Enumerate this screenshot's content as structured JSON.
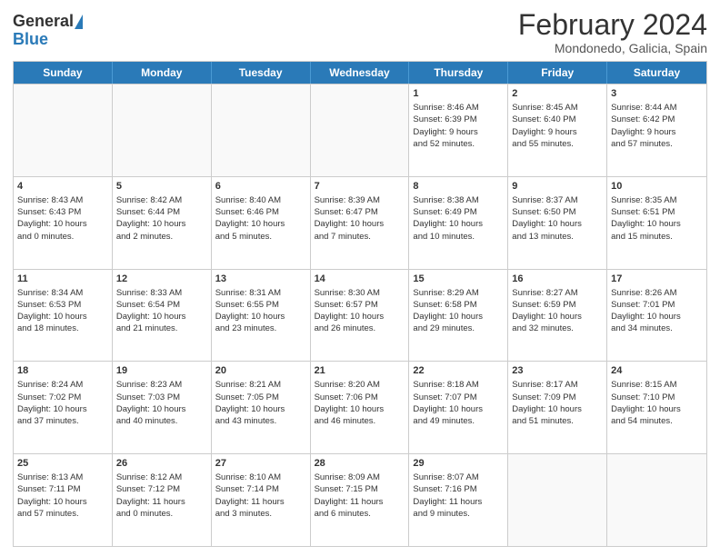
{
  "header": {
    "logo_general": "General",
    "logo_blue": "Blue",
    "month_year": "February 2024",
    "location": "Mondonedo, Galicia, Spain"
  },
  "days_of_week": [
    "Sunday",
    "Monday",
    "Tuesday",
    "Wednesday",
    "Thursday",
    "Friday",
    "Saturday"
  ],
  "weeks": [
    [
      {
        "day": "",
        "info": ""
      },
      {
        "day": "",
        "info": ""
      },
      {
        "day": "",
        "info": ""
      },
      {
        "day": "",
        "info": ""
      },
      {
        "day": "1",
        "info": "Sunrise: 8:46 AM\nSunset: 6:39 PM\nDaylight: 9 hours\nand 52 minutes."
      },
      {
        "day": "2",
        "info": "Sunrise: 8:45 AM\nSunset: 6:40 PM\nDaylight: 9 hours\nand 55 minutes."
      },
      {
        "day": "3",
        "info": "Sunrise: 8:44 AM\nSunset: 6:42 PM\nDaylight: 9 hours\nand 57 minutes."
      }
    ],
    [
      {
        "day": "4",
        "info": "Sunrise: 8:43 AM\nSunset: 6:43 PM\nDaylight: 10 hours\nand 0 minutes."
      },
      {
        "day": "5",
        "info": "Sunrise: 8:42 AM\nSunset: 6:44 PM\nDaylight: 10 hours\nand 2 minutes."
      },
      {
        "day": "6",
        "info": "Sunrise: 8:40 AM\nSunset: 6:46 PM\nDaylight: 10 hours\nand 5 minutes."
      },
      {
        "day": "7",
        "info": "Sunrise: 8:39 AM\nSunset: 6:47 PM\nDaylight: 10 hours\nand 7 minutes."
      },
      {
        "day": "8",
        "info": "Sunrise: 8:38 AM\nSunset: 6:49 PM\nDaylight: 10 hours\nand 10 minutes."
      },
      {
        "day": "9",
        "info": "Sunrise: 8:37 AM\nSunset: 6:50 PM\nDaylight: 10 hours\nand 13 minutes."
      },
      {
        "day": "10",
        "info": "Sunrise: 8:35 AM\nSunset: 6:51 PM\nDaylight: 10 hours\nand 15 minutes."
      }
    ],
    [
      {
        "day": "11",
        "info": "Sunrise: 8:34 AM\nSunset: 6:53 PM\nDaylight: 10 hours\nand 18 minutes."
      },
      {
        "day": "12",
        "info": "Sunrise: 8:33 AM\nSunset: 6:54 PM\nDaylight: 10 hours\nand 21 minutes."
      },
      {
        "day": "13",
        "info": "Sunrise: 8:31 AM\nSunset: 6:55 PM\nDaylight: 10 hours\nand 23 minutes."
      },
      {
        "day": "14",
        "info": "Sunrise: 8:30 AM\nSunset: 6:57 PM\nDaylight: 10 hours\nand 26 minutes."
      },
      {
        "day": "15",
        "info": "Sunrise: 8:29 AM\nSunset: 6:58 PM\nDaylight: 10 hours\nand 29 minutes."
      },
      {
        "day": "16",
        "info": "Sunrise: 8:27 AM\nSunset: 6:59 PM\nDaylight: 10 hours\nand 32 minutes."
      },
      {
        "day": "17",
        "info": "Sunrise: 8:26 AM\nSunset: 7:01 PM\nDaylight: 10 hours\nand 34 minutes."
      }
    ],
    [
      {
        "day": "18",
        "info": "Sunrise: 8:24 AM\nSunset: 7:02 PM\nDaylight: 10 hours\nand 37 minutes."
      },
      {
        "day": "19",
        "info": "Sunrise: 8:23 AM\nSunset: 7:03 PM\nDaylight: 10 hours\nand 40 minutes."
      },
      {
        "day": "20",
        "info": "Sunrise: 8:21 AM\nSunset: 7:05 PM\nDaylight: 10 hours\nand 43 minutes."
      },
      {
        "day": "21",
        "info": "Sunrise: 8:20 AM\nSunset: 7:06 PM\nDaylight: 10 hours\nand 46 minutes."
      },
      {
        "day": "22",
        "info": "Sunrise: 8:18 AM\nSunset: 7:07 PM\nDaylight: 10 hours\nand 49 minutes."
      },
      {
        "day": "23",
        "info": "Sunrise: 8:17 AM\nSunset: 7:09 PM\nDaylight: 10 hours\nand 51 minutes."
      },
      {
        "day": "24",
        "info": "Sunrise: 8:15 AM\nSunset: 7:10 PM\nDaylight: 10 hours\nand 54 minutes."
      }
    ],
    [
      {
        "day": "25",
        "info": "Sunrise: 8:13 AM\nSunset: 7:11 PM\nDaylight: 10 hours\nand 57 minutes."
      },
      {
        "day": "26",
        "info": "Sunrise: 8:12 AM\nSunset: 7:12 PM\nDaylight: 11 hours\nand 0 minutes."
      },
      {
        "day": "27",
        "info": "Sunrise: 8:10 AM\nSunset: 7:14 PM\nDaylight: 11 hours\nand 3 minutes."
      },
      {
        "day": "28",
        "info": "Sunrise: 8:09 AM\nSunset: 7:15 PM\nDaylight: 11 hours\nand 6 minutes."
      },
      {
        "day": "29",
        "info": "Sunrise: 8:07 AM\nSunset: 7:16 PM\nDaylight: 11 hours\nand 9 minutes."
      },
      {
        "day": "",
        "info": ""
      },
      {
        "day": "",
        "info": ""
      }
    ]
  ]
}
